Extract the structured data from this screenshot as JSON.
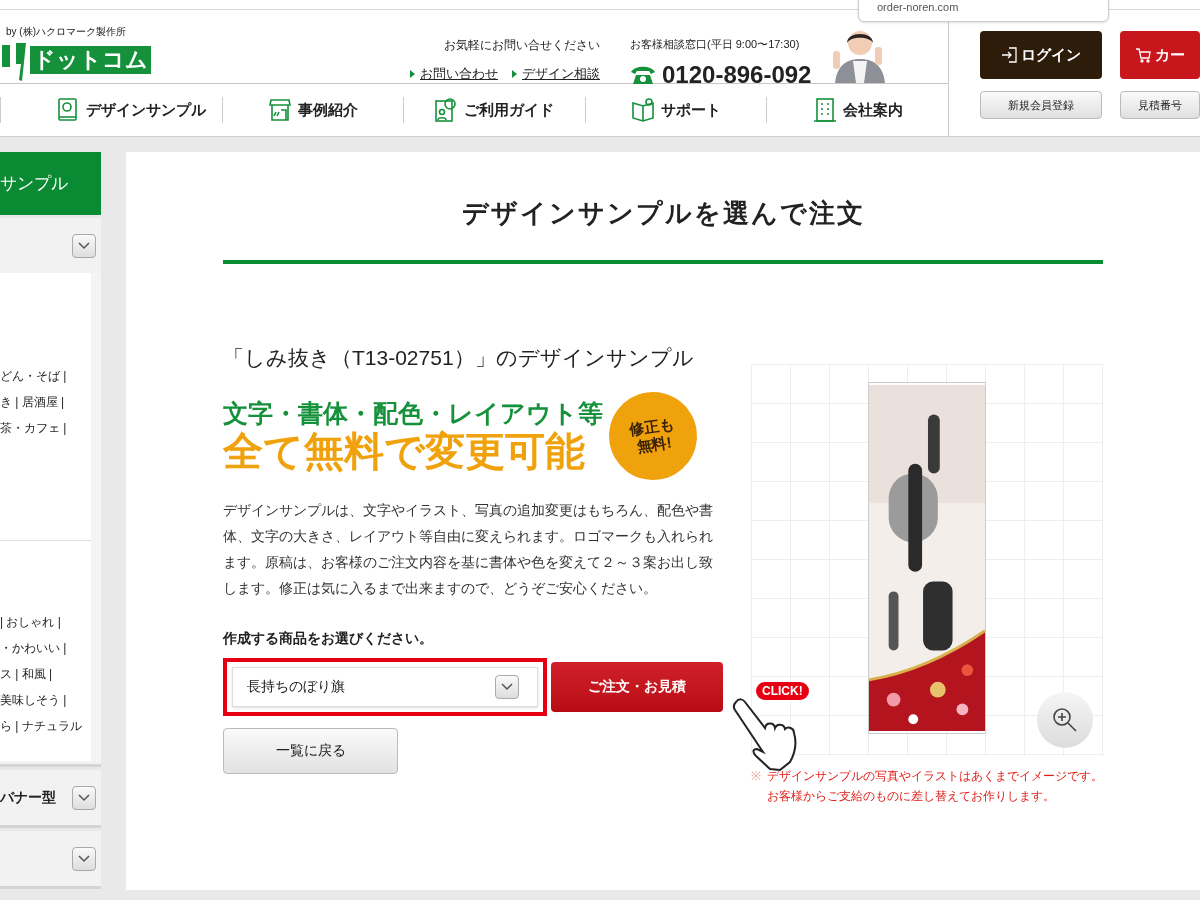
{
  "tooltip": {
    "text": "order-noren.com"
  },
  "header": {
    "tagline": "by (株)ハクロマーク製作所",
    "logo_text": "ドットコム",
    "contact_note": "お気軽にお問い合せください",
    "links": [
      "お問い合わせ",
      "デザイン相談"
    ],
    "phone_label": "お客様相談窓口(平日 9:00〜17:30)",
    "phone": "0120-896-092",
    "nav": [
      {
        "kind": "book",
        "label": "デザインサンプル"
      },
      {
        "kind": "shop",
        "label": "事例紹介"
      },
      {
        "kind": "guide",
        "label": "ご利用ガイド"
      },
      {
        "kind": "support",
        "label": "サポート"
      },
      {
        "kind": "building",
        "label": "会社案内"
      }
    ],
    "account_buttons": [
      {
        "kind": "login",
        "label": "ログイン"
      },
      {
        "kind": "cart",
        "label": "カー"
      }
    ],
    "sub_buttons": [
      "新規会員登録",
      "見積番号"
    ]
  },
  "sidebar": {
    "title": "サンプル",
    "sections": [
      {
        "expanded": true
      },
      {
        "title": "バナー型",
        "expanded": false
      },
      {
        "expanded": false
      }
    ],
    "groups": [
      [
        "どん・そば |",
        "き |  居酒屋 |",
        "茶・カフェ |"
      ],
      [
        "|  おしゃれ |",
        "・かわいい |",
        "ス |  和風 |",
        "美味しそう |",
        "ら |  ナチュラル"
      ]
    ]
  },
  "main": {
    "title": "デザインサンプルを選んで注文",
    "subtitle": "「しみ抜き（T13-02751）」のデザインサンプル",
    "promo": {
      "line1": "文字・書体・配色・レイアウト等",
      "line2": "全て無料で変更可能",
      "badge": [
        "修正も",
        "無料!"
      ]
    },
    "description": "デザインサンプルは、文字やイラスト、写真の追加変更はもちろん、配色や書体、文字の大きさ、レイアウト等自由に変えられます。ロゴマークも入れられます。原稿は、お客様のご注文内容を基に書体や色を変えて２～３案お出し致します。修正は気に入るまで出来ますので、どうぞご安心ください。",
    "select_label": "作成する商品をお選びください。",
    "select_value": "長持ちのぼり旗",
    "order_button": "ご注文・お見積",
    "click_bubble": "CLICK!",
    "back_button": "一覧に戻る",
    "notes": [
      "※",
      "デザインサンプルの写真やイラストはあくまでイメージです。",
      "お客様からご支給のものに差し替えてお作りします。"
    ]
  }
}
